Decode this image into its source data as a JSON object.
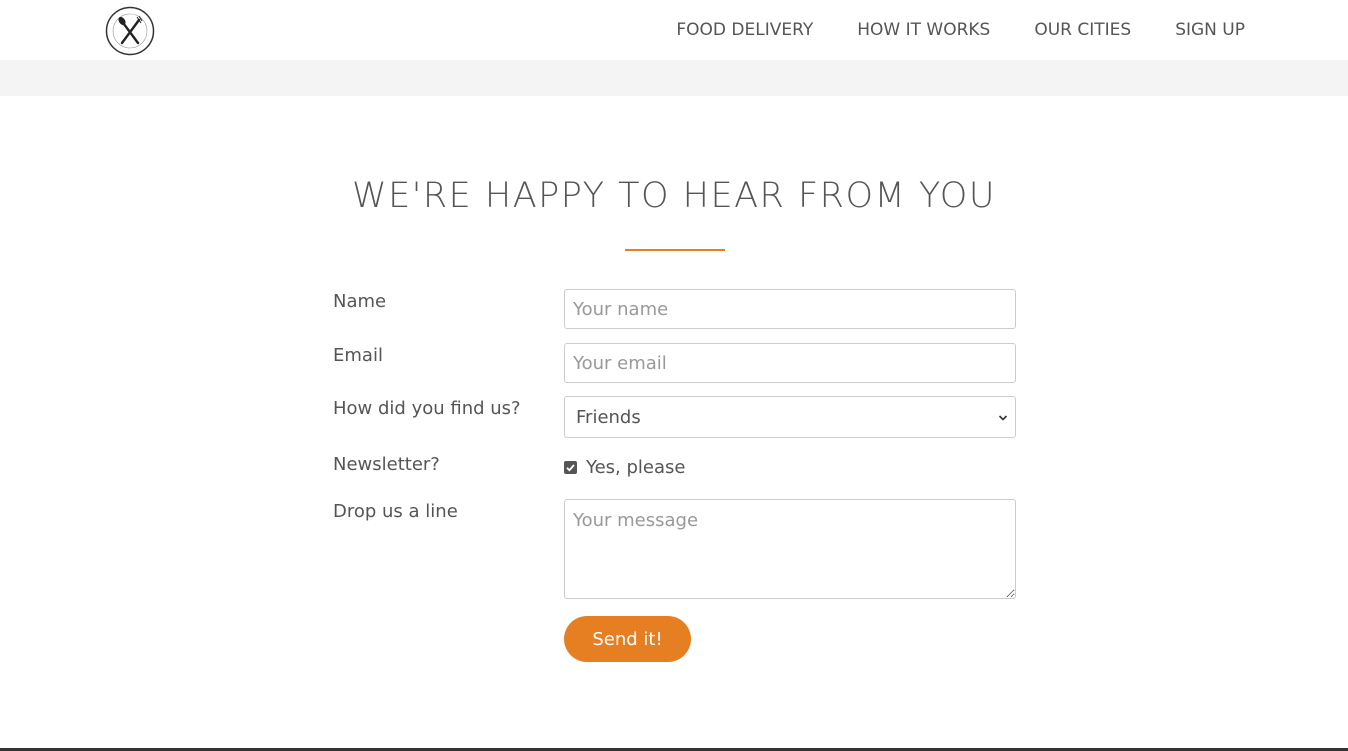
{
  "header": {
    "logo_icon": "fork-and-knife-logo-icon",
    "nav": [
      {
        "label": "FOOD DELIVERY"
      },
      {
        "label": "HOW IT WORKS"
      },
      {
        "label": "OUR CITIES"
      },
      {
        "label": "SIGN UP"
      }
    ]
  },
  "form": {
    "title": "WE'RE HAPPY TO HEAR FROM YOU",
    "accent_color": "#e67e22",
    "name": {
      "label": "Name",
      "placeholder": "Your name",
      "value": ""
    },
    "email": {
      "label": "Email",
      "placeholder": "Your email",
      "value": ""
    },
    "find_us": {
      "label": "How did you find us?",
      "selected": "Friends"
    },
    "newsletter": {
      "label": "Newsletter?",
      "checkbox_label": "Yes, please",
      "checked": true
    },
    "message": {
      "label": "Drop us a line",
      "placeholder": "Your message",
      "value": ""
    },
    "submit_label": "Send it!"
  }
}
